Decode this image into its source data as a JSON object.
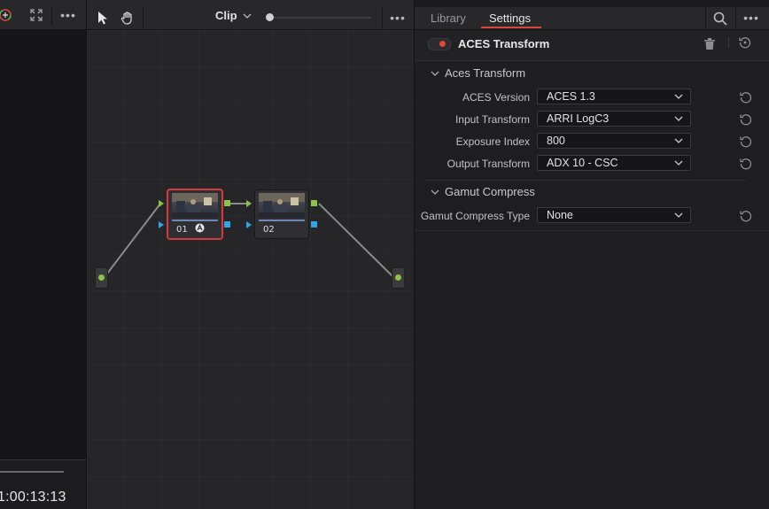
{
  "left_panel": {
    "timecode": "1:00:13:13"
  },
  "node_editor": {
    "clip_label": "Clip",
    "nodes": [
      {
        "label": "01"
      },
      {
        "label": "02"
      }
    ]
  },
  "inspector": {
    "tabs": {
      "library": "Library",
      "settings": "Settings"
    },
    "effect": {
      "title": "ACES Transform",
      "enabled": true
    },
    "sections": {
      "aces": {
        "title": "Aces Transform",
        "rows": [
          {
            "label": "ACES Version",
            "value": "ACES 1.3"
          },
          {
            "label": "Input Transform",
            "value": "ARRI LogC3"
          },
          {
            "label": "Exposure Index",
            "value": "800"
          },
          {
            "label": "Output Transform",
            "value": "ADX 10 - CSC"
          }
        ]
      },
      "gamut": {
        "title": "Gamut Compress",
        "rows": [
          {
            "label": "Gamut Compress Type",
            "value": "None"
          }
        ]
      }
    }
  },
  "colors": {
    "accent_red": "#d9443c",
    "port_green": "#8bc34a",
    "port_blue": "#2fa4e7"
  }
}
